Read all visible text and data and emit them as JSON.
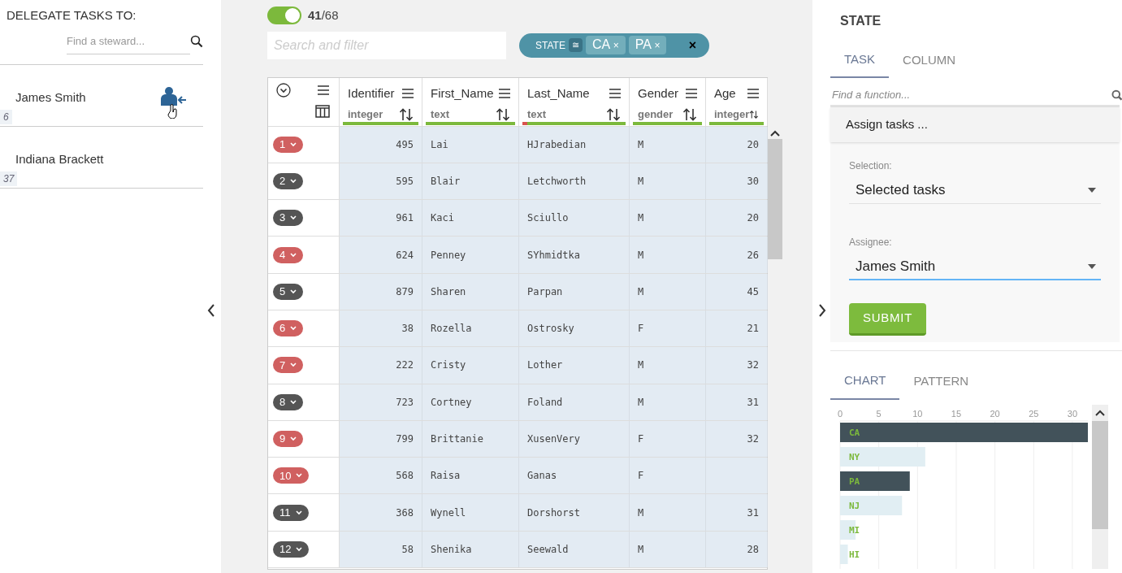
{
  "delegate": {
    "title": "DELEGATE TASKS TO:",
    "search": {
      "placeholder": "Find a steward..."
    },
    "stewards": [
      {
        "name": "James Smith",
        "count": "6",
        "hovered": true
      },
      {
        "name": "Indiana Brackett",
        "count": "37",
        "hovered": false
      }
    ]
  },
  "toolbar": {
    "toggle_on": true,
    "count": "41",
    "separator": "/",
    "total": "68",
    "search": {
      "placeholder": "Search and filter"
    },
    "filter": {
      "label": "STATE",
      "operator": "≅",
      "values": [
        {
          "text": "CA",
          "remove": "×"
        },
        {
          "text": "PA",
          "remove": "×"
        }
      ],
      "close": "×"
    }
  },
  "table": {
    "columns": [
      {
        "name": "Identifier",
        "type": "integer",
        "level": 1
      },
      {
        "name": "First_Name",
        "type": "text",
        "level": 1
      },
      {
        "name": "Last_Name",
        "type": "text",
        "level": 0.95
      },
      {
        "name": "Gender",
        "type": "gender",
        "level": 1
      },
      {
        "name": "Age",
        "type": "integer",
        "level": 1
      }
    ],
    "rows": [
      {
        "index": "1",
        "color": "#d06060",
        "cells": [
          "495",
          "Lai",
          "HJrabedian",
          "M",
          "20"
        ]
      },
      {
        "index": "2",
        "color": "#555555",
        "cells": [
          "595",
          "Blair",
          "Letchworth",
          "M",
          "30"
        ]
      },
      {
        "index": "3",
        "color": "#555555",
        "cells": [
          "961",
          "Kaci",
          "Sciullo",
          "M",
          "20"
        ]
      },
      {
        "index": "4",
        "color": "#d06060",
        "cells": [
          "624",
          "Penney",
          "SYhmidtka",
          "M",
          "26"
        ]
      },
      {
        "index": "5",
        "color": "#555555",
        "cells": [
          "879",
          "Sharen",
          "Parpan",
          "M",
          "45"
        ]
      },
      {
        "index": "6",
        "color": "#d06060",
        "cells": [
          "38",
          "Rozella",
          "Ostrosky",
          "F",
          "21"
        ]
      },
      {
        "index": "7",
        "color": "#d06060",
        "cells": [
          "222",
          "Cristy",
          "Lother",
          "M",
          "32"
        ]
      },
      {
        "index": "8",
        "color": "#555555",
        "cells": [
          "723",
          "Cortney",
          "Foland",
          "M",
          "31"
        ]
      },
      {
        "index": "9",
        "color": "#d06060",
        "cells": [
          "799",
          "Brittanie",
          "XusenVery",
          "F",
          "32"
        ]
      },
      {
        "index": "10",
        "color": "#d06060",
        "cells": [
          "568",
          "Raisa",
          "Ganas",
          "F",
          ""
        ]
      },
      {
        "index": "11",
        "color": "#555555",
        "cells": [
          "368",
          "Wynell",
          "Dorshorst",
          "M",
          "31"
        ]
      },
      {
        "index": "12",
        "color": "#555555",
        "cells": [
          "58",
          "Shenika",
          "Seewald",
          "M",
          "28"
        ]
      }
    ]
  },
  "side": {
    "title": "STATE",
    "tabs": [
      {
        "label": "TASK",
        "selected": true
      },
      {
        "label": "COLUMN",
        "selected": false
      }
    ],
    "search": {
      "placeholder": "Find a function..."
    },
    "action": "Assign tasks ...",
    "fields": [
      {
        "label": "Selection:",
        "value": "Selected tasks",
        "focused": false
      },
      {
        "label": "Assignee:",
        "value": "James Smith",
        "focused": true
      }
    ],
    "submit": "SUBMIT",
    "chart_tabs": [
      {
        "label": "CHART",
        "selected": true
      },
      {
        "label": "PATTERN",
        "selected": false
      }
    ],
    "chart_data": {
      "type": "bar",
      "orientation": "horizontal",
      "grid": true,
      "categories": [
        "CA",
        "NY",
        "PA",
        "NJ",
        "MI",
        "HI"
      ],
      "series": [
        {
          "color": "#42525a",
          "values": [
            32,
            null,
            9,
            null,
            null,
            null
          ]
        },
        {
          "color": "#e1eef3",
          "values": [
            null,
            11,
            null,
            8,
            2,
            1
          ]
        }
      ],
      "xlim": [
        0,
        32
      ],
      "xticks": [
        0,
        5,
        10,
        15,
        20,
        25,
        30
      ]
    }
  }
}
